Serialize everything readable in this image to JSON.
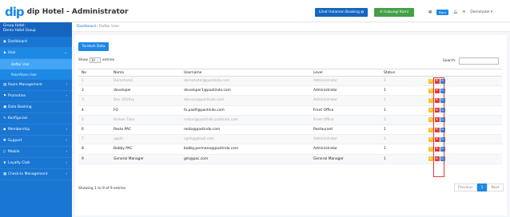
{
  "app": {
    "logo_mark": "dip",
    "title": "dip Hotel - Administrator"
  },
  "header": {
    "booking_button": "Lihat Halaman Booking",
    "hub_button": "Hubungi Kami",
    "new_badge": "Baru",
    "user_label": "Demohotel"
  },
  "sidebar": {
    "group_label": "Group Hotel:",
    "group_name": "Demo Hotel Group",
    "items": [
      {
        "label": "Dashboard",
        "icon": "dashboard-icon"
      },
      {
        "label": "User",
        "icon": "user-icon"
      },
      {
        "label": "Room Management",
        "icon": "room-icon"
      },
      {
        "label": "Promotion",
        "icon": "tag-icon"
      },
      {
        "label": "Data Booking",
        "icon": "booking-icon"
      },
      {
        "label": "Konfigurasi",
        "icon": "config-icon"
      },
      {
        "label": "Membership",
        "icon": "member-icon"
      },
      {
        "label": "Support",
        "icon": "support-icon"
      },
      {
        "label": "Mobile",
        "icon": "mobile-icon"
      },
      {
        "label": "Loyalty Club",
        "icon": "loyalty-icon"
      },
      {
        "label": "Check-In Management",
        "icon": "checkin-icon"
      }
    ],
    "user_subitems": [
      "Daftar User",
      "Role/Akses User"
    ]
  },
  "breadcrumb": {
    "root": "Dashboard",
    "sep": "/",
    "current": "Daftar User"
  },
  "main": {
    "add_button": "Tambah Data",
    "show_label": "Show",
    "show_value": "10",
    "entries_label": "entries",
    "search_label": "Search:",
    "columns": [
      "No",
      "Nama",
      "Username",
      "Level",
      "Status"
    ],
    "rows": [
      {
        "no": "1",
        "name": "Demohotel",
        "username": "demohotel@pastindo.com",
        "level": "Administrator",
        "status": "1",
        "faded": true
      },
      {
        "no": "2",
        "name": "developer",
        "username": "developer1@pastindo.com",
        "level": "Administrator",
        "status": "1",
        "faded": false
      },
      {
        "no": "3",
        "name": "Dev 2016xs",
        "username": "dev.sys@pastindo.com",
        "level": "Administrator",
        "status": "1",
        "faded": true
      },
      {
        "no": "4",
        "name": "FO",
        "username": "fo.pastf@pastindo.com",
        "level": "Front Office",
        "status": "1",
        "faded": false
      },
      {
        "no": "5",
        "name": "Rinkan Tuka",
        "username": "rinkan@pastindo.pastindo.com",
        "level": "Front Office",
        "status": "1",
        "faded": true
      },
      {
        "no": "6",
        "name": "Resto PAC",
        "username": "resto@pastindo.com",
        "level": "Restaurant",
        "status": "1",
        "faded": false
      },
      {
        "no": "7",
        "name": "agshi",
        "username": "agsh@gmail.com",
        "level": "Administrator",
        "status": "1",
        "faded": true
      },
      {
        "no": "8",
        "name": "Bobby PAC",
        "username": "bobby.permana@pastindo.com",
        "level": "Administrator",
        "status": "1",
        "faded": false
      },
      {
        "no": "9",
        "name": "General Manager",
        "username": "gm@pac.com",
        "level": "General Manager",
        "status": "1",
        "faded": false
      }
    ],
    "info": "Showing 1 to 9 of 9 entries",
    "pager": {
      "prev": "Previous",
      "page": "1",
      "next": "Next"
    }
  },
  "colors": {
    "primary": "#1976d2",
    "edit": "#fbc02d",
    "delete": "#e53935",
    "view": "#1e88e5",
    "highlight": "#e53935"
  }
}
